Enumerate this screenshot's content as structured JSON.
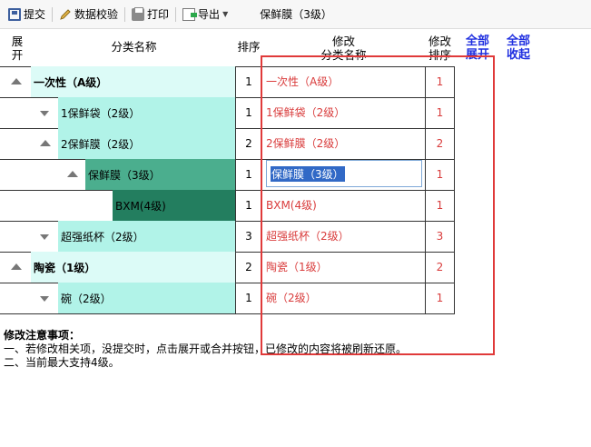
{
  "toolbar": {
    "submit": "提交",
    "validate": "数据校验",
    "print": "打印",
    "export": "导出",
    "title": "保鲜膜（3级）"
  },
  "header": {
    "expand": "展\n开",
    "category_name": "分类名称",
    "sort": "排序",
    "edit_name": "修改\n分类名称",
    "edit_sort": "修改\n排序",
    "expand_all": "全部\n展开",
    "collapse_all": "全部\n收起"
  },
  "colors": {
    "level0": "#dcfbf7",
    "level1": "#b1f3e8",
    "level2": "#4bae8e",
    "level3": "#237e5f",
    "edit_text": "#d93c3c",
    "header_blue": "#1f2fe0",
    "highlight_box": "#e03a3a"
  },
  "rows": [
    {
      "level": 0,
      "state": "expanded",
      "name": "一次性（A级）",
      "sort": "1",
      "edit_name": "一次性（A级）",
      "edit_sort": "1"
    },
    {
      "level": 1,
      "state": "collapsed",
      "name": "1保鲜袋（2级）",
      "sort": "1",
      "edit_name": "1保鲜袋（2级）",
      "edit_sort": "1"
    },
    {
      "level": 1,
      "state": "expanded",
      "name": "2保鲜膜（2级）",
      "sort": "2",
      "edit_name": "2保鲜膜（2级）",
      "edit_sort": "2"
    },
    {
      "level": 2,
      "state": "expanded",
      "name": "保鲜膜（3级）",
      "sort": "1",
      "edit_name": "保鲜膜（3级）",
      "edit_sort": "1",
      "editing": true
    },
    {
      "level": 3,
      "state": "leaf",
      "name": "BXM(4级)",
      "sort": "1",
      "edit_name": "BXM(4级)",
      "edit_sort": "1"
    },
    {
      "level": 1,
      "state": "collapsed",
      "name": "超强纸杯（2级）",
      "sort": "3",
      "edit_name": "超强纸杯（2级）",
      "edit_sort": "3"
    },
    {
      "level": 0,
      "state": "expanded",
      "name": "陶瓷（1级）",
      "sort": "2",
      "edit_name": "陶瓷（1级）",
      "edit_sort": "2"
    },
    {
      "level": 1,
      "state": "collapsed",
      "name": "碗（2级）",
      "sort": "1",
      "edit_name": "碗（2级）",
      "edit_sort": "1"
    }
  ],
  "notes": {
    "title": "修改注意事项：",
    "line1": "一、若修改相关项，没提交时，点击展开或合并按钮，已修改的内容将被刷新还原。",
    "line2": "二、当前最大支持4级。"
  }
}
